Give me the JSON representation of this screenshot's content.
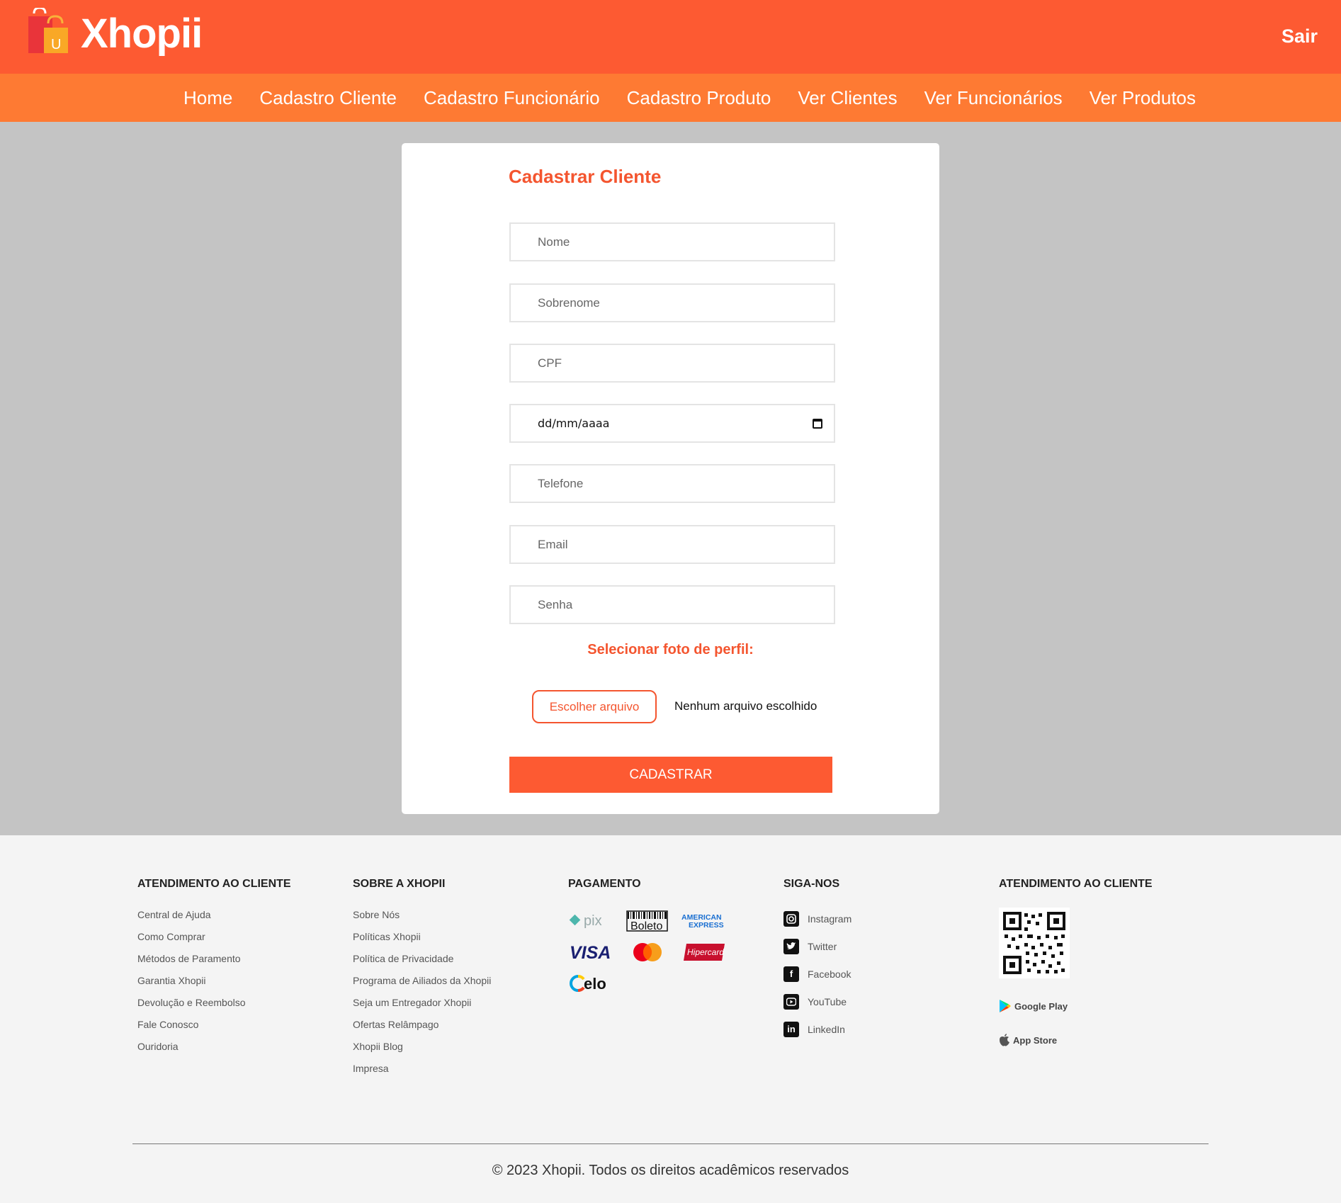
{
  "header": {
    "brand": "Xhopii",
    "logo_letter": "U",
    "logout_label": "Sair"
  },
  "nav": {
    "items": [
      "Home",
      "Cadastro Cliente",
      "Cadastro Funcionário",
      "Cadastro Produto",
      "Ver Clientes",
      "Ver Funcionários",
      "Ver Produtos"
    ]
  },
  "form": {
    "title": "Cadastrar Cliente",
    "fields": {
      "nome": "Nome",
      "sobrenome": "Sobrenome",
      "cpf": "CPF",
      "data": "dd/mm/aaaa",
      "telefone": "Telefone",
      "email": "Email",
      "senha": "Senha"
    },
    "photo_label": "Selecionar foto de perfil:",
    "file_button": "Escolher arquivo",
    "file_status": "Nenhum arquivo escolhido",
    "submit_label": "CADASTRAR"
  },
  "footer": {
    "col1": {
      "title": "ATENDIMENTO AO CLIENTE",
      "links": [
        "Central de Ajuda",
        "Como Comprar",
        "Métodos de Paramento",
        "Garantia Xhopii",
        "Devolução e Reembolso",
        "Fale Conosco",
        "Ouridoria"
      ]
    },
    "col2": {
      "title": "SOBRE A XHOPII",
      "links": [
        "Sobre Nós",
        "Políticas Xhopii",
        "Política de Privacidade",
        "Programa de Ailiados da Xhopii",
        "Seja um Entregador Xhopii",
        "Ofertas Relâmpago",
        "Xhopii Blog",
        "Impresa"
      ]
    },
    "col3": {
      "title": "PAGAMENTO",
      "methods": {
        "pix": "pix",
        "boleto": "Boleto",
        "amex_line1": "AMERICAN",
        "amex_line2": "EXPRESS",
        "visa": "VISA",
        "hipercard": "Hipercard",
        "elo": "elo"
      }
    },
    "col4": {
      "title": "SIGA-NOS",
      "links": [
        "Instagram",
        "Twitter",
        "Facebook",
        "YouTube",
        "LinkedIn"
      ]
    },
    "col5": {
      "title": "ATENDIMENTO AO CLIENTE",
      "google_play": "Google Play",
      "app_store": "App Store"
    },
    "copyright": "© 2023 Xhopii. Todos os direitos acadêmicos reservados"
  },
  "colors": {
    "header": "#fd5a32",
    "nav": "#fe7a33",
    "accent": "#f4552f",
    "page_bg": "#c4c4c4",
    "footer_bg": "#f4f4f4"
  }
}
